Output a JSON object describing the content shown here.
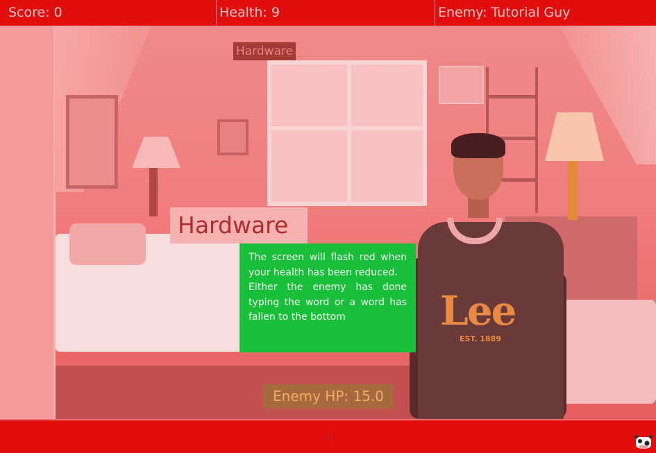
{
  "hud": {
    "score": "Score: 0",
    "health": "Health: 9",
    "enemy": "Enemy: Tutorial Guy"
  },
  "words": {
    "falling_word": "Hardware",
    "target_word": "Hardware"
  },
  "tutorial": {
    "line1": "The screen will flash red when your health has been reduced.",
    "line2": "Either the enemy has done typing the word or a word has fallen to the bottom"
  },
  "enemy_hp": "Enemy HP: 15.0",
  "input": {
    "typed": "L"
  },
  "colors": {
    "hud_bar": "#e20d0d",
    "flash_overlay": "#f08080",
    "tutorial_bg": "#18c03a",
    "enemy_hp_bg": "#a56a3e"
  },
  "icons": {
    "corner": "cow-mascot-icon"
  }
}
